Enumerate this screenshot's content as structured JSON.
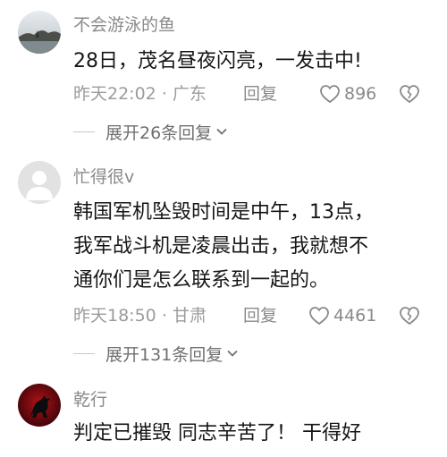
{
  "comments": [
    {
      "username": "不会游泳的鱼",
      "content_lines": [
        "28日，茂名昼夜闪亮，一发击中!"
      ],
      "time": "昨天22:02",
      "location": "广东",
      "reply_label": "回复",
      "likes": "896",
      "expand_label": "展开26条回复"
    },
    {
      "username": "忙得很v",
      "content_lines": [
        "韩国军机坠毁时间是中午，13点，",
        "我军战斗机是凌晨出击，我就想不",
        "通你们是怎么联系到一起的。"
      ],
      "time": "昨天18:50",
      "location": "甘肃",
      "reply_label": "回复",
      "likes": "4461",
      "expand_label": "展开131条回复"
    },
    {
      "username": "乾行",
      "content_lines": [
        "判定已摧毁 同志辛苦了！ 干得好"
      ]
    }
  ],
  "separator": "·",
  "colors": {
    "text": "#161616",
    "meta": "#9c9c9c",
    "expand": "#6f6f6f"
  },
  "icons": {
    "like": "heart-outline-icon",
    "dislike": "broken-heart-icon",
    "expand": "chevron-down-icon"
  }
}
